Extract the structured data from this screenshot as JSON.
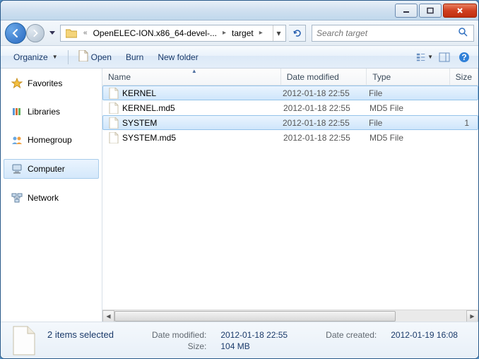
{
  "titlebar": {},
  "nav": {
    "path_prefix": "«",
    "path_seg1": "OpenELEC-ION.x86_64-devel-...",
    "path_seg2": "target",
    "search_placeholder": "Search target"
  },
  "toolbar": {
    "organize": "Organize",
    "open": "Open",
    "burn": "Burn",
    "newfolder": "New folder"
  },
  "sidebar": {
    "items": [
      {
        "label": "Favorites"
      },
      {
        "label": "Libraries"
      },
      {
        "label": "Homegroup"
      },
      {
        "label": "Computer"
      },
      {
        "label": "Network"
      }
    ]
  },
  "columns": {
    "name": "Name",
    "date": "Date modified",
    "type": "Type",
    "size": "Size"
  },
  "files": [
    {
      "name": "KERNEL",
      "date": "2012-01-18 22:55",
      "type": "File",
      "size": "",
      "selected": true
    },
    {
      "name": "KERNEL.md5",
      "date": "2012-01-18 22:55",
      "type": "MD5 File",
      "size": "",
      "selected": false
    },
    {
      "name": "SYSTEM",
      "date": "2012-01-18 22:55",
      "type": "File",
      "size": "1",
      "selected": true
    },
    {
      "name": "SYSTEM.md5",
      "date": "2012-01-18 22:55",
      "type": "MD5 File",
      "size": "",
      "selected": false
    }
  ],
  "details": {
    "title": "2 items selected",
    "modified_label": "Date modified:",
    "modified_value": "2012-01-18 22:55",
    "created_label": "Date created:",
    "created_value": "2012-01-19 16:08",
    "size_label": "Size:",
    "size_value": "104 MB"
  }
}
